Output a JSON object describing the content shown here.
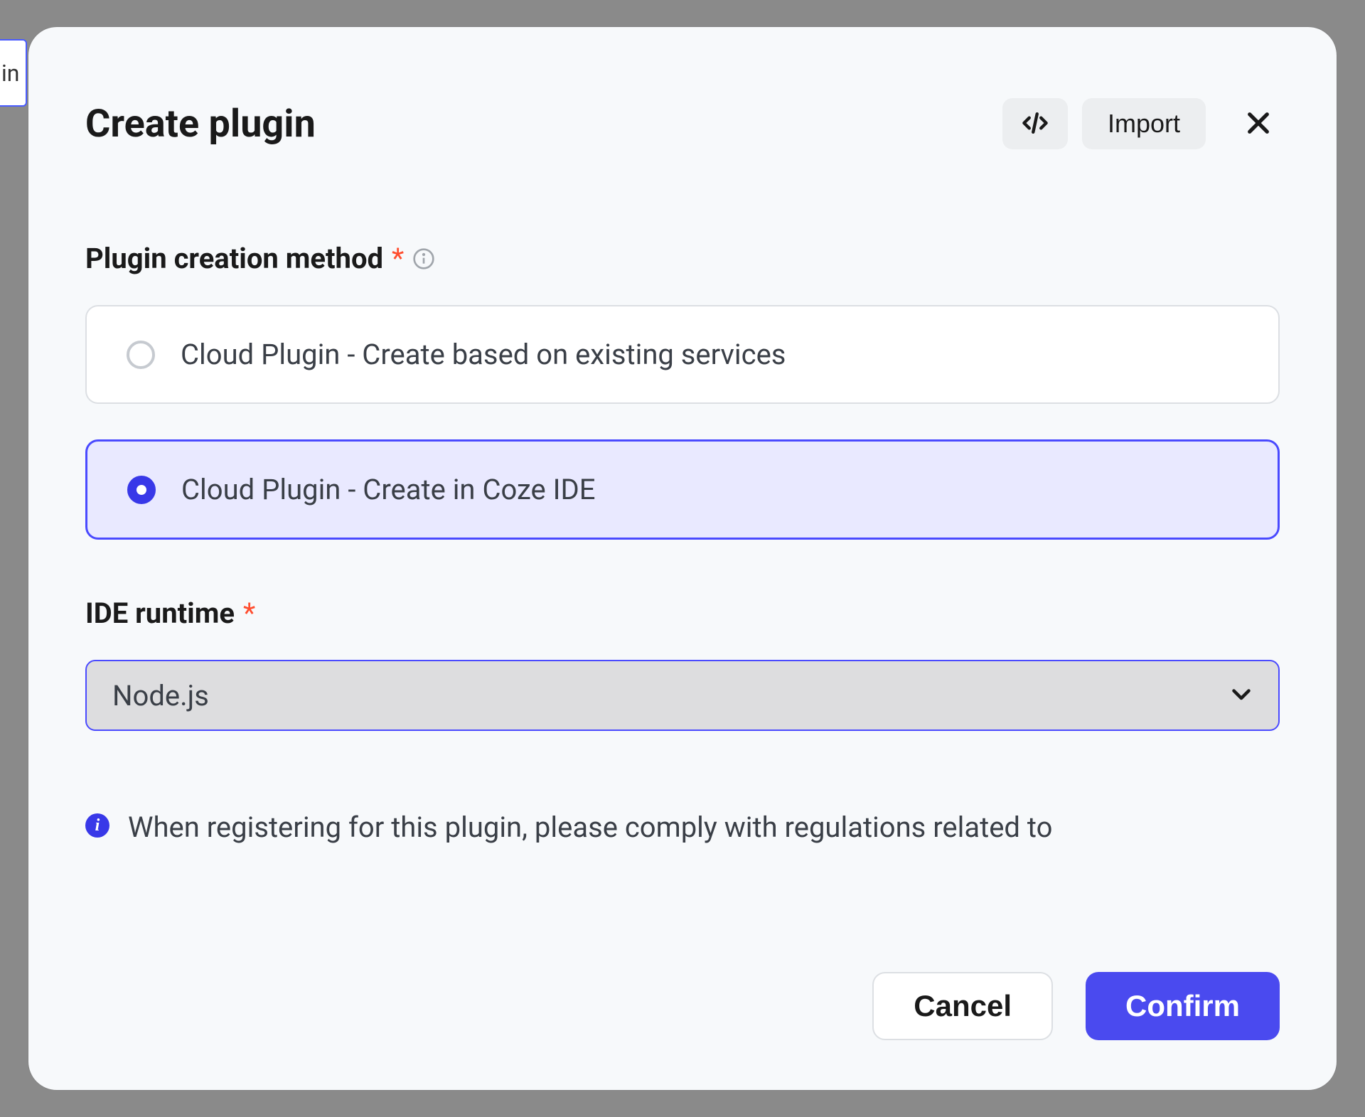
{
  "backdrop_text": "in",
  "modal": {
    "title": "Create plugin",
    "import_label": "Import"
  },
  "form": {
    "creation_method": {
      "label": "Plugin creation method",
      "options": [
        {
          "label": "Cloud Plugin - Create based on existing services",
          "selected": false
        },
        {
          "label": "Cloud Plugin - Create in Coze IDE",
          "selected": true
        }
      ]
    },
    "ide_runtime": {
      "label": "IDE runtime",
      "value": "Node.js"
    },
    "notice": "When registering for this plugin, please comply with regulations related to"
  },
  "footer": {
    "cancel_label": "Cancel",
    "confirm_label": "Confirm"
  }
}
